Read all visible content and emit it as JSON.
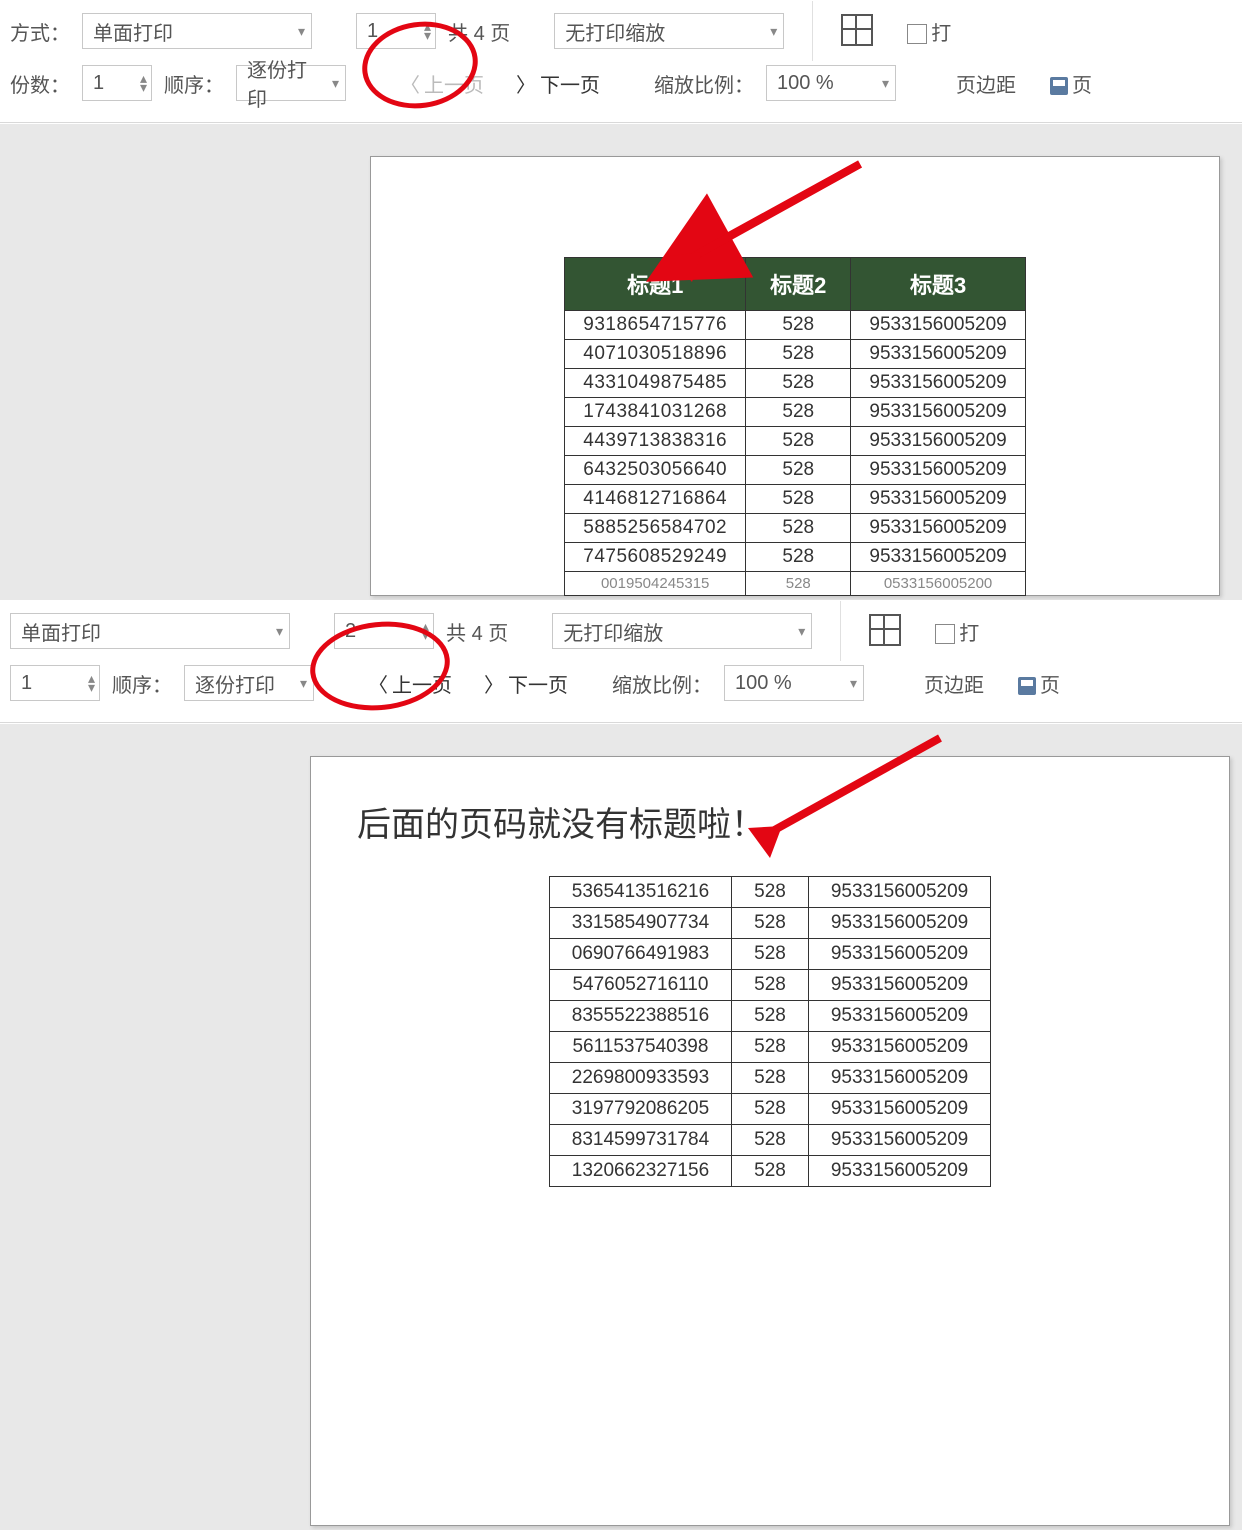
{
  "toolbar": {
    "labels": {
      "mode": "方式：",
      "copies": "份数：",
      "order": "顺序：",
      "total_pages_prefix": "共",
      "total_pages_suffix": "页",
      "prev": "上一页",
      "next": "下一页",
      "zoom_ratio": "缩放比例：",
      "margins": "页边距",
      "print_short": "打",
      "page_short": "页"
    },
    "mode_value": "单面打印",
    "copies_value": "1",
    "order_value": "逐份打印",
    "zoom_value": "无打印缩放",
    "zoom_pct_value": "100 %",
    "total_pages": "4"
  },
  "panel1": {
    "page_value": "1",
    "table": {
      "headers": [
        "标题1",
        "标题2",
        "标题3"
      ],
      "rows": [
        [
          "9318654715776",
          "528",
          "9533156005209"
        ],
        [
          "4071030518896",
          "528",
          "9533156005209"
        ],
        [
          "4331049875485",
          "528",
          "9533156005209"
        ],
        [
          "1743841031268",
          "528",
          "9533156005209"
        ],
        [
          "4439713838316",
          "528",
          "9533156005209"
        ],
        [
          "6432503056640",
          "528",
          "9533156005209"
        ],
        [
          "4146812716864",
          "528",
          "9533156005209"
        ],
        [
          "5885256584702",
          "528",
          "9533156005209"
        ],
        [
          "7475608529249",
          "528",
          "9533156005209"
        ]
      ],
      "cutoff_row": [
        "0019504245315",
        "528",
        "0533156005200"
      ]
    }
  },
  "panel2": {
    "page_value": "2",
    "caption": "后面的页码就没有标题啦！",
    "table": {
      "rows": [
        [
          "5365413516216",
          "528",
          "9533156005209"
        ],
        [
          "3315854907734",
          "528",
          "9533156005209"
        ],
        [
          "0690766491983",
          "528",
          "9533156005209"
        ],
        [
          "5476052716110",
          "528",
          "9533156005209"
        ],
        [
          "8355522388516",
          "528",
          "9533156005209"
        ],
        [
          "5611537540398",
          "528",
          "9533156005209"
        ],
        [
          "2269800933593",
          "528",
          "9533156005209"
        ],
        [
          "3197792086205",
          "528",
          "9533156005209"
        ],
        [
          "8314599731784",
          "528",
          "9533156005209"
        ],
        [
          "1320662327156",
          "528",
          "9533156005209"
        ]
      ]
    }
  }
}
